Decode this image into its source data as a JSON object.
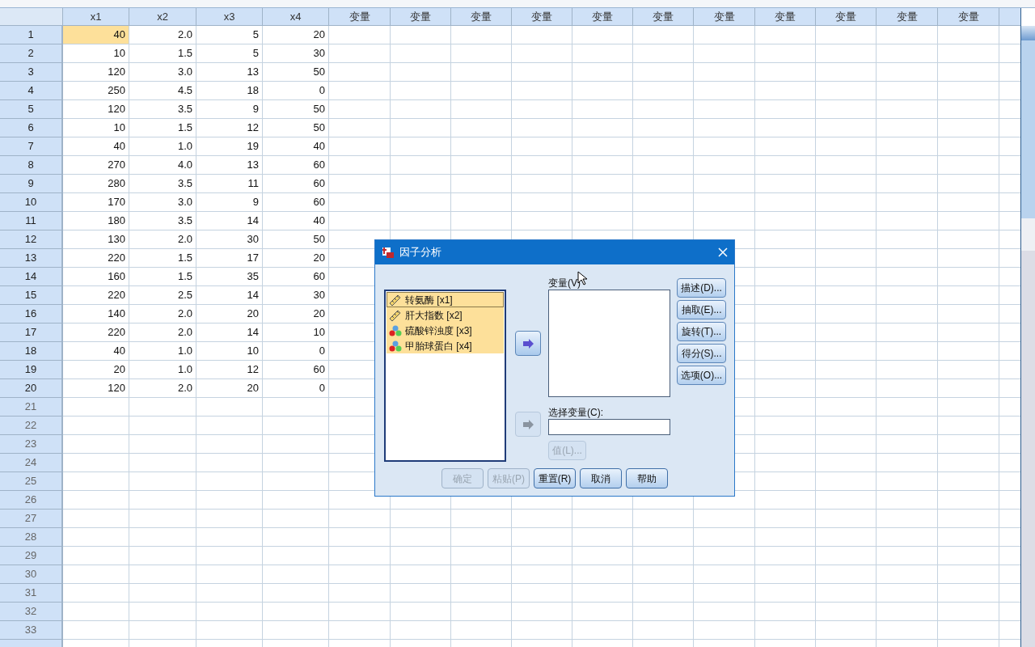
{
  "grid": {
    "columns": [
      "x1",
      "x2",
      "x3",
      "x4",
      "变量",
      "变量",
      "变量",
      "变量",
      "变量",
      "变量",
      "变量",
      "变量",
      "变量",
      "变量",
      "变量"
    ],
    "rows": [
      {
        "number": "1",
        "cells": [
          {
            "value": "40",
            "selected": true
          },
          {
            "value": "2.0",
            "selected": false
          },
          {
            "value": "5",
            "selected": false
          },
          {
            "value": "20",
            "selected": false
          }
        ]
      },
      {
        "number": "2",
        "cells": [
          {
            "value": "10",
            "selected": false
          },
          {
            "value": "1.5",
            "selected": false
          },
          {
            "value": "5",
            "selected": false
          },
          {
            "value": "30",
            "selected": false
          }
        ]
      },
      {
        "number": "3",
        "cells": [
          {
            "value": "120",
            "selected": false
          },
          {
            "value": "3.0",
            "selected": false
          },
          {
            "value": "13",
            "selected": false
          },
          {
            "value": "50",
            "selected": false
          }
        ]
      },
      {
        "number": "4",
        "cells": [
          {
            "value": "250",
            "selected": false
          },
          {
            "value": "4.5",
            "selected": false
          },
          {
            "value": "18",
            "selected": false
          },
          {
            "value": "0",
            "selected": false
          }
        ]
      },
      {
        "number": "5",
        "cells": [
          {
            "value": "120",
            "selected": false
          },
          {
            "value": "3.5",
            "selected": false
          },
          {
            "value": "9",
            "selected": false
          },
          {
            "value": "50",
            "selected": false
          }
        ]
      },
      {
        "number": "6",
        "cells": [
          {
            "value": "10",
            "selected": false
          },
          {
            "value": "1.5",
            "selected": false
          },
          {
            "value": "12",
            "selected": false
          },
          {
            "value": "50",
            "selected": false
          }
        ]
      },
      {
        "number": "7",
        "cells": [
          {
            "value": "40",
            "selected": false
          },
          {
            "value": "1.0",
            "selected": false
          },
          {
            "value": "19",
            "selected": false
          },
          {
            "value": "40",
            "selected": false
          }
        ]
      },
      {
        "number": "8",
        "cells": [
          {
            "value": "270",
            "selected": false
          },
          {
            "value": "4.0",
            "selected": false
          },
          {
            "value": "13",
            "selected": false
          },
          {
            "value": "60",
            "selected": false
          }
        ]
      },
      {
        "number": "9",
        "cells": [
          {
            "value": "280",
            "selected": false
          },
          {
            "value": "3.5",
            "selected": false
          },
          {
            "value": "11",
            "selected": false
          },
          {
            "value": "60",
            "selected": false
          }
        ]
      },
      {
        "number": "10",
        "cells": [
          {
            "value": "170",
            "selected": false
          },
          {
            "value": "3.0",
            "selected": false
          },
          {
            "value": "9",
            "selected": false
          },
          {
            "value": "60",
            "selected": false
          }
        ]
      },
      {
        "number": "11",
        "cells": [
          {
            "value": "180",
            "selected": false
          },
          {
            "value": "3.5",
            "selected": false
          },
          {
            "value": "14",
            "selected": false
          },
          {
            "value": "40",
            "selected": false
          }
        ]
      },
      {
        "number": "12",
        "cells": [
          {
            "value": "130",
            "selected": false
          },
          {
            "value": "2.0",
            "selected": false
          },
          {
            "value": "30",
            "selected": false
          },
          {
            "value": "50",
            "selected": false
          }
        ]
      },
      {
        "number": "13",
        "cells": [
          {
            "value": "220",
            "selected": false
          },
          {
            "value": "1.5",
            "selected": false
          },
          {
            "value": "17",
            "selected": false
          },
          {
            "value": "20",
            "selected": false
          }
        ]
      },
      {
        "number": "14",
        "cells": [
          {
            "value": "160",
            "selected": false
          },
          {
            "value": "1.5",
            "selected": false
          },
          {
            "value": "35",
            "selected": false
          },
          {
            "value": "60",
            "selected": false
          }
        ]
      },
      {
        "number": "15",
        "cells": [
          {
            "value": "220",
            "selected": false
          },
          {
            "value": "2.5",
            "selected": false
          },
          {
            "value": "14",
            "selected": false
          },
          {
            "value": "30",
            "selected": false
          }
        ]
      },
      {
        "number": "16",
        "cells": [
          {
            "value": "140",
            "selected": false
          },
          {
            "value": "2.0",
            "selected": false
          },
          {
            "value": "20",
            "selected": false
          },
          {
            "value": "20",
            "selected": false
          }
        ]
      },
      {
        "number": "17",
        "cells": [
          {
            "value": "220",
            "selected": false
          },
          {
            "value": "2.0",
            "selected": false
          },
          {
            "value": "14",
            "selected": false
          },
          {
            "value": "10",
            "selected": false
          }
        ]
      },
      {
        "number": "18",
        "cells": [
          {
            "value": "40",
            "selected": false
          },
          {
            "value": "1.0",
            "selected": false
          },
          {
            "value": "10",
            "selected": false
          },
          {
            "value": "0",
            "selected": false
          }
        ]
      },
      {
        "number": "19",
        "cells": [
          {
            "value": "20",
            "selected": false
          },
          {
            "value": "1.0",
            "selected": false
          },
          {
            "value": "12",
            "selected": false
          },
          {
            "value": "60",
            "selected": false
          }
        ]
      },
      {
        "number": "20",
        "cells": [
          {
            "value": "120",
            "selected": false
          },
          {
            "value": "2.0",
            "selected": false
          },
          {
            "value": "20",
            "selected": false
          },
          {
            "value": "0",
            "selected": false
          }
        ]
      },
      {
        "number": "21"
      },
      {
        "number": "22"
      },
      {
        "number": "23"
      },
      {
        "number": "24"
      },
      {
        "number": "25"
      },
      {
        "number": "26"
      },
      {
        "number": "27"
      },
      {
        "number": "28"
      },
      {
        "number": "29"
      },
      {
        "number": "30"
      },
      {
        "number": "31"
      },
      {
        "number": "32"
      },
      {
        "number": "33"
      }
    ]
  },
  "dialog": {
    "title": "因子分析",
    "source_list": [
      {
        "label": "转氨酶 [x1]",
        "kind": "scale",
        "selected": true
      },
      {
        "label": "肝大指数 [x2]",
        "kind": "scale",
        "selected": true
      },
      {
        "label": "硫酸锌浊度 [x3]",
        "kind": "nominal",
        "selected": true
      },
      {
        "label": "甲胎球蛋白 [x4]",
        "kind": "nominal",
        "selected": true
      }
    ],
    "variables_label": "变量(V)",
    "variables_arrow": {
      "disabled": false
    },
    "selection_label": "选择变量(C):",
    "selection_arrow": {
      "disabled": true
    },
    "value_button": {
      "label": "值(L)...",
      "disabled": true
    },
    "side_buttons": [
      "描述(D)...",
      "抽取(E)...",
      "旋转(T)...",
      "得分(S)...",
      "选项(O)..."
    ],
    "bottom_buttons": [
      {
        "label": "确定",
        "disabled": true
      },
      {
        "label": "粘贴(P)",
        "disabled": true
      },
      {
        "label": "重置(R)",
        "disabled": false
      },
      {
        "label": "取消",
        "disabled": false
      },
      {
        "label": "帮助",
        "disabled": false
      }
    ]
  }
}
